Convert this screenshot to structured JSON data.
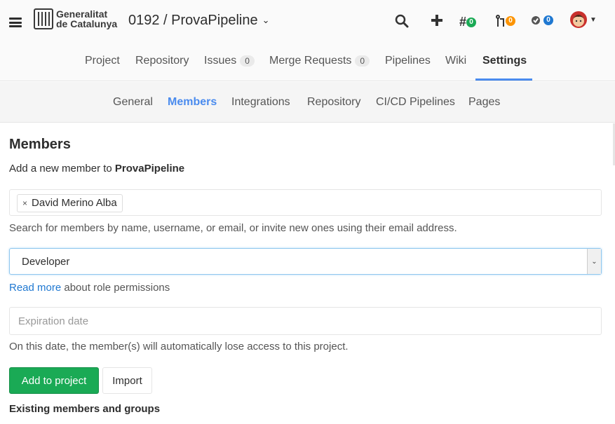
{
  "header": {
    "logo_line1": "Generalitat",
    "logo_line2": "de Catalunya",
    "project_title": "0192 / ProvaPipeline",
    "issues_badge": "0",
    "mr_badge": "0",
    "todos_badge": "0"
  },
  "topnav": {
    "items": [
      {
        "label": "Project"
      },
      {
        "label": "Repository"
      },
      {
        "label": "Issues",
        "count": "0"
      },
      {
        "label": "Merge Requests",
        "count": "0"
      },
      {
        "label": "Pipelines"
      },
      {
        "label": "Wiki"
      },
      {
        "label": "Settings",
        "active": true
      }
    ]
  },
  "subnav": {
    "items": [
      {
        "label": "General"
      },
      {
        "label": "Members",
        "active": true
      },
      {
        "label": "Integrations"
      },
      {
        "label": "Repository"
      },
      {
        "label": "CI/CD Pipelines"
      },
      {
        "label": "Pages"
      }
    ]
  },
  "members": {
    "heading": "Members",
    "add_prefix": "Add a new member to ",
    "project_name": "ProvaPipeline",
    "token": "David Merino Alba",
    "token_remove": "×",
    "search_hint": "Search for members by name, username, or email, or invite new ones using their email address.",
    "role_value": "Developer",
    "read_more_link": "Read more",
    "read_more_suffix": " about role permissions",
    "expiration_placeholder": "Expiration date",
    "expiration_hint": "On this date, the member(s) will automatically lose access to this project.",
    "add_button": "Add to project",
    "import_button": "Import",
    "existing_heading": "Existing members and groups"
  },
  "colors": {
    "accent": "#4a8bee",
    "success": "#1aaa55",
    "warning": "#fc9403",
    "link": "#1f78d1"
  }
}
